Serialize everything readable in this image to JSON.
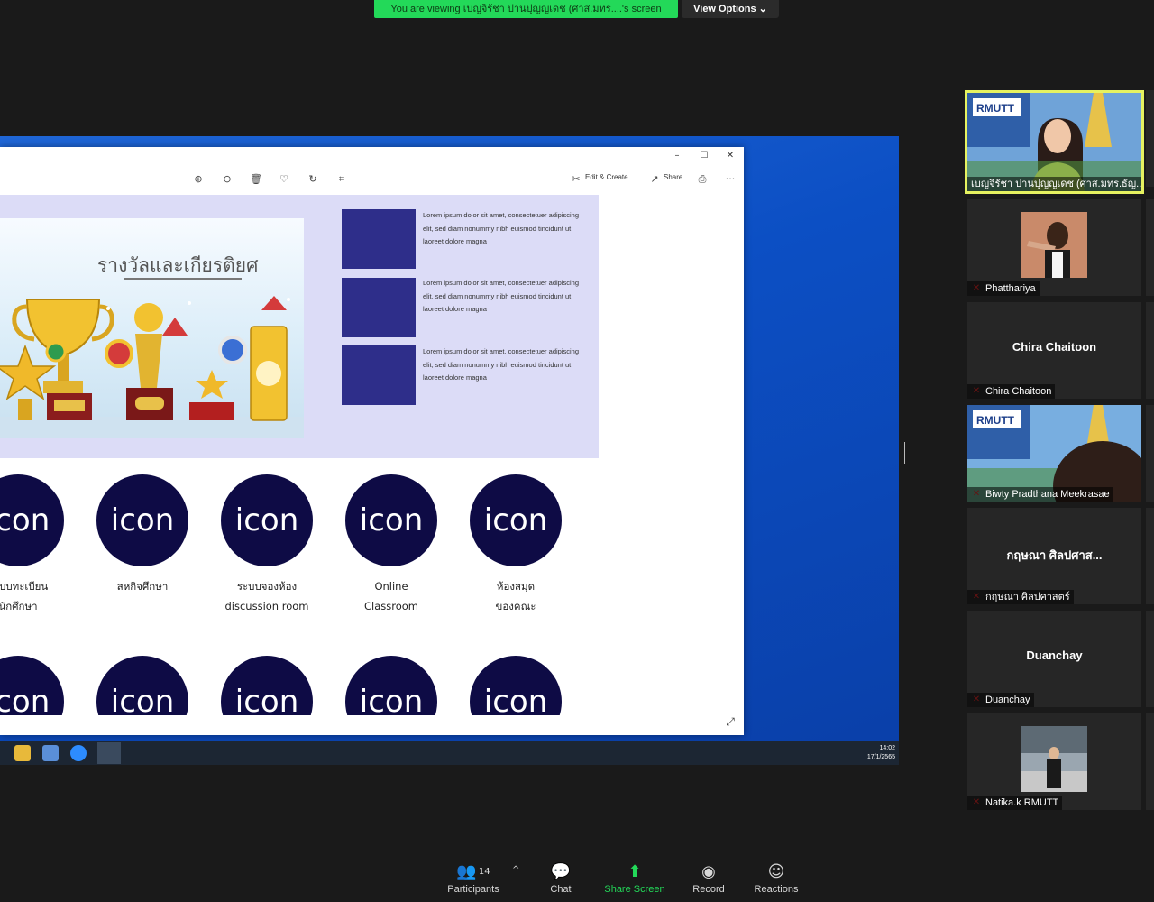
{
  "banner": {
    "sharing_text": "You are viewing เบญจิรัชา ปานปุญญเดช (ศาส.มทร....'s screen",
    "view_options_label": "View Options ⌄"
  },
  "shared_screen": {
    "photos_toolbar": {
      "zoom_in_icon": "zoom-in-icon",
      "edit_create_label": "Edit & Create",
      "share_label": "Share",
      "more_label": "···"
    },
    "slide": {
      "awards_title": "รางวัลและเกียรติยศ",
      "lorem": [
        "Lorem ipsum dolor sit amet, consectetuer adipiscing elit, sed diam nonummy nibh euismod tincidunt ut laoreet dolore magna",
        "Lorem ipsum dolor sit amet, consectetuer adipiscing elit, sed diam nonummy nibh euismod tincidunt ut laoreet dolore magna",
        "Lorem ipsum dolor sit amet, consectetuer adipiscing elit, sed diam nonummy nibh euismod tincidunt ut laoreet dolore magna"
      ],
      "icon_text": "icon",
      "icon_labels": [
        [
          "ระบบทะเบียน",
          "นักศึกษา"
        ],
        [
          "สหกิจศึกษา",
          ""
        ],
        [
          "ระบบจองห้อง",
          "discussion room"
        ],
        [
          "Online",
          "Classroom"
        ],
        [
          "ห้องสมุด",
          "ของคณะ"
        ]
      ]
    },
    "clock": {
      "time": "14:02",
      "date": "17/1/2565"
    }
  },
  "participants": [
    {
      "name": "เบญจิรัชา ปานปุญญเดช (ศาส.มทร.ธัญ...",
      "video": true,
      "active": true
    },
    {
      "name": "Phatthariya",
      "video": true
    },
    {
      "name": "Chira Chaitoon",
      "display": "Chira Chaitoon"
    },
    {
      "name": "Biwty Pradthana Meekrasae",
      "video": true
    },
    {
      "name": "กฤษณา  ศิลปศาสตร์",
      "display": "กฤษณา  ศิลปศาส..."
    },
    {
      "name": "Duanchay",
      "display": "Duanchay"
    },
    {
      "name": "Natika.k RMUTT",
      "video": true
    }
  ],
  "controls": {
    "participants_label": "Participants",
    "participants_count": "14",
    "chat_label": "Chat",
    "share_label": "Share Screen",
    "record_label": "Record",
    "reactions_label": "Reactions"
  },
  "colors": {
    "share_green": "#23d959",
    "icon_navy": "#0e0b45",
    "slide_lavender": "#dcdcf7",
    "square_blue": "#2e2e8a",
    "active_border": "#e6f260"
  }
}
